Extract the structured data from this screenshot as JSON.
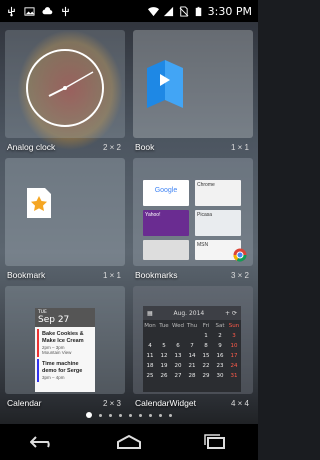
{
  "status_bar": {
    "time": "3:30 PM",
    "left_icons": [
      "usb-icon",
      "image-icon",
      "cloud-upload-icon",
      "usb-debug-icon"
    ],
    "right_icons": [
      "wifi-icon",
      "signal-icon",
      "no-sim-icon",
      "battery-icon"
    ]
  },
  "widgets": [
    {
      "name": "Analog clock",
      "size": "2 × 2"
    },
    {
      "name": "Book",
      "size": "1 × 1"
    },
    {
      "name": "Bookmark",
      "size": "1 × 1"
    },
    {
      "name": "Bookmarks",
      "size": "3 × 2"
    },
    {
      "name": "Calendar",
      "size": "2 × 3"
    },
    {
      "name": "CalendarWidget",
      "size": "4 × 4"
    }
  ],
  "calendar_preview": {
    "day": "TUE",
    "date": "Sep 27",
    "events": [
      {
        "title": "Bake Cookies & Make Ice Cream",
        "time": "2pm – 3pm",
        "place": "Mountain View"
      },
      {
        "title": "Time machine demo for Serge",
        "time": "3pm – 4pm"
      }
    ]
  },
  "calendar_widget_preview": {
    "month": "Aug. 2014",
    "weekdays": [
      "Mon",
      "Tue",
      "Wed",
      "Thu",
      "Fri",
      "Sat",
      "Sun"
    ],
    "weeks": [
      [
        "",
        "",
        "",
        "",
        "1",
        "2",
        "3"
      ],
      [
        "4",
        "5",
        "6",
        "7",
        "8",
        "9",
        "10"
      ],
      [
        "11",
        "12",
        "13",
        "14",
        "15",
        "16",
        "17"
      ],
      [
        "18",
        "19",
        "20",
        "21",
        "22",
        "23",
        "24"
      ],
      [
        "25",
        "26",
        "27",
        "28",
        "29",
        "30",
        "31"
      ]
    ]
  },
  "bookmarks_preview": {
    "tiles": [
      "Google",
      "Chrome",
      "Picasa",
      "Yahoo!",
      "MSN"
    ]
  },
  "page_indicator": {
    "count": 9,
    "active": 0
  },
  "nav": [
    "back-button",
    "home-button",
    "recents-button"
  ]
}
